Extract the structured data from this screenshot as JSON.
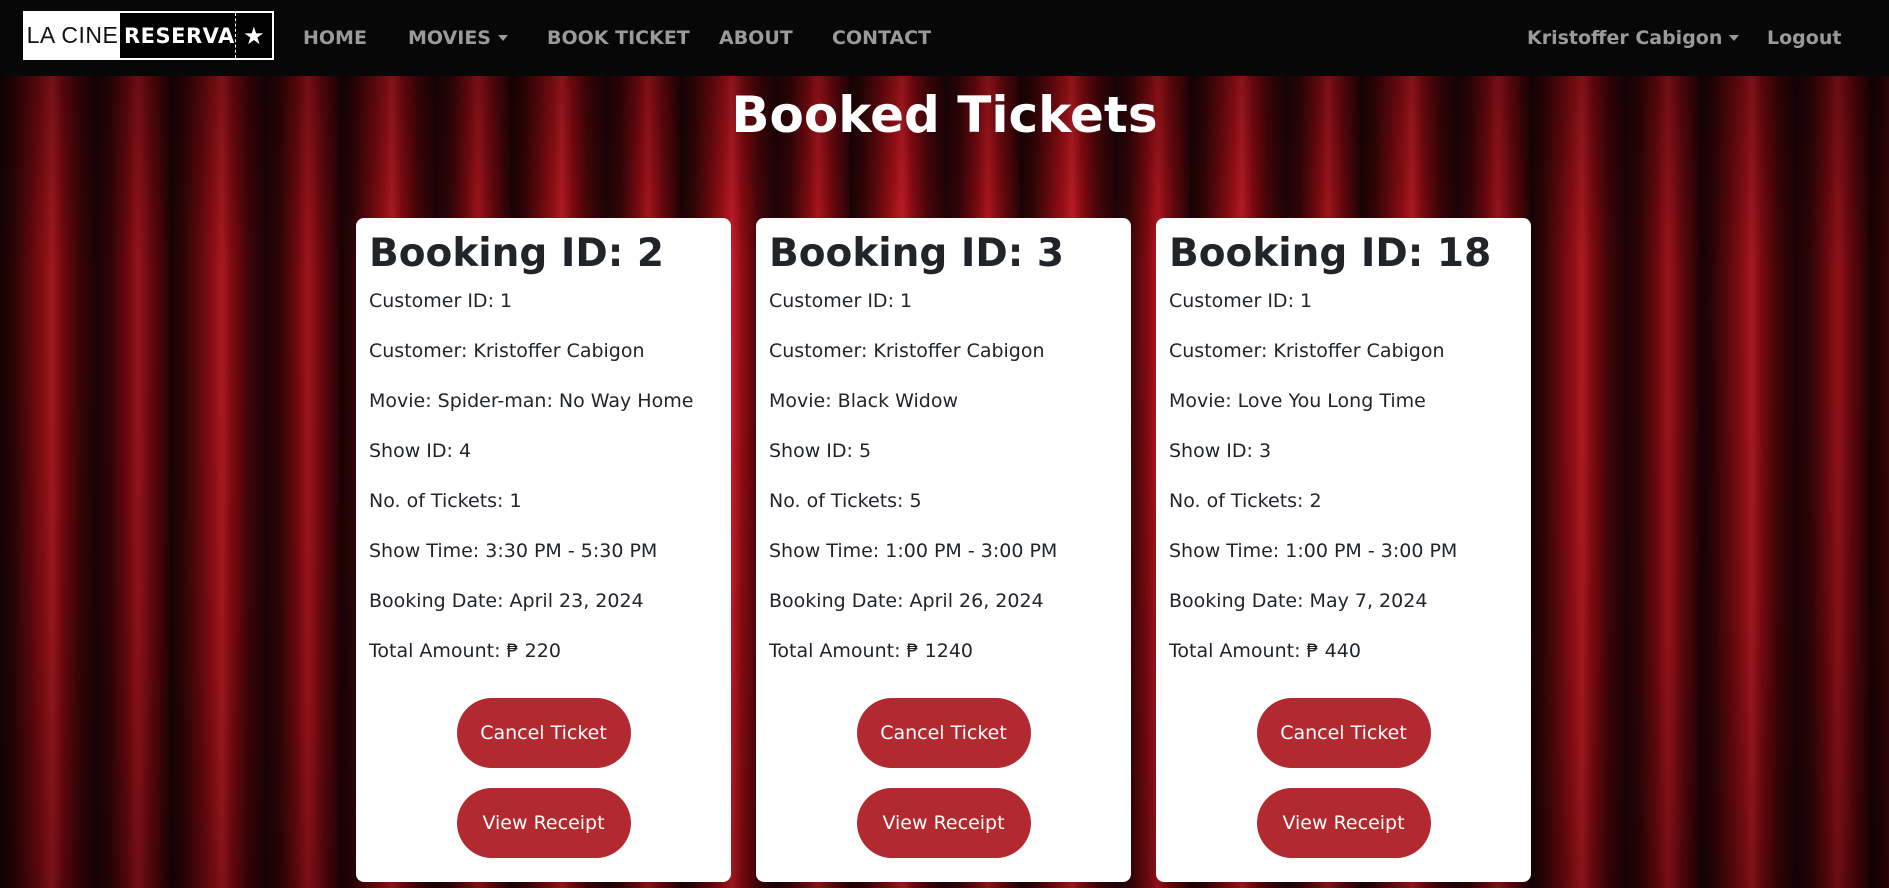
{
  "nav": {
    "logo_left": "LA CINE",
    "logo_right": "RESERVA",
    "logo_star": "★",
    "home": "HOME",
    "movies": "MOVIES",
    "book_ticket": "BOOK TICKET",
    "about": "ABOUT",
    "contact": "CONTACT",
    "user": "Kristoffer Cabigon",
    "logout": "Logout"
  },
  "page": {
    "title": "Booked Tickets"
  },
  "bookings": [
    {
      "heading": "Booking ID: 2",
      "customer_id": "Customer ID: 1",
      "customer": "Customer: Kristoffer Cabigon",
      "movie": "Movie: Spider-man: No Way Home",
      "show_id": "Show ID: 4",
      "tickets": "No. of Tickets: 1",
      "show_time": "Show Time: 3:30 PM - 5:30 PM",
      "booking_date": "Booking Date: April 23, 2024",
      "total": "Total Amount: ₱ 220",
      "cancel_label": "Cancel Ticket",
      "receipt_label": "View Receipt"
    },
    {
      "heading": "Booking ID: 3",
      "customer_id": "Customer ID: 1",
      "customer": "Customer: Kristoffer Cabigon",
      "movie": "Movie: Black Widow",
      "show_id": "Show ID: 5",
      "tickets": "No. of Tickets: 5",
      "show_time": "Show Time: 1:00 PM - 3:00 PM",
      "booking_date": "Booking Date: April 26, 2024",
      "total": "Total Amount: ₱ 1240",
      "cancel_label": "Cancel Ticket",
      "receipt_label": "View Receipt"
    },
    {
      "heading": "Booking ID: 18",
      "customer_id": "Customer ID: 1",
      "customer": "Customer: Kristoffer Cabigon",
      "movie": "Movie: Love You Long Time",
      "show_id": "Show ID: 3",
      "tickets": "No. of Tickets: 2",
      "show_time": "Show Time: 1:00 PM - 3:00 PM",
      "booking_date": "Booking Date: May 7, 2024",
      "total": "Total Amount: ₱ 440",
      "cancel_label": "Cancel Ticket",
      "receipt_label": "View Receipt"
    }
  ],
  "colors": {
    "navbar_bg": "#070707",
    "nav_text": "#9a9a9a",
    "button_bg": "#b22a30",
    "card_bg": "#ffffff",
    "curtain_red": "#b3121a"
  }
}
